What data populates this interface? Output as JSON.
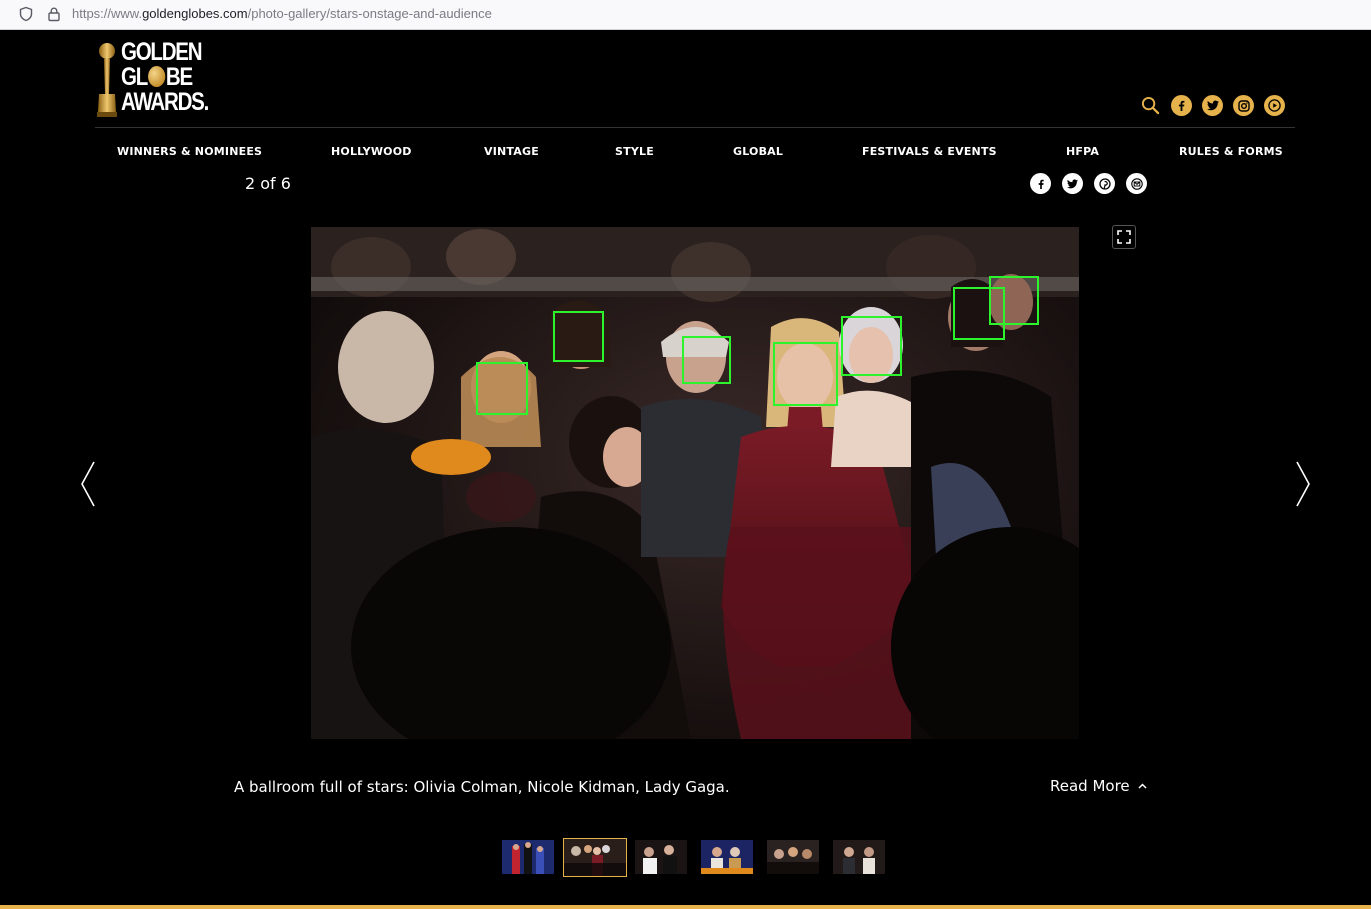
{
  "browser": {
    "url_prefix": "https://www.",
    "url_host": "goldenglobes.com",
    "url_path": "/photo-gallery/stars-onstage-and-audience"
  },
  "header": {
    "logo_line1": "GOLDEN",
    "logo_line2_a": "GL",
    "logo_line2_b": "BE",
    "logo_line3": "AWARDS.",
    "accent": "#e6b24c",
    "icons": [
      "search-icon",
      "facebook-icon",
      "twitter-icon",
      "instagram-icon",
      "youtube-icon"
    ]
  },
  "nav": {
    "items": [
      "WINNERS & NOMINEES",
      "HOLLYWOOD",
      "VINTAGE",
      "STYLE",
      "GLOBAL",
      "FESTIVALS & EVENTS",
      "HFPA",
      "RULES & FORMS"
    ]
  },
  "gallery": {
    "counter": "2 of 6",
    "current": 2,
    "total": 6,
    "share_icons": [
      "facebook-icon",
      "twitter-icon",
      "pinterest-icon",
      "email-icon"
    ],
    "caption": "A ballroom full of stars: Olivia Colman, Nicole Kidman, Lady Gaga.",
    "read_more": "Read More",
    "face_box_color": "#2df32d",
    "thumbnails": 6
  }
}
